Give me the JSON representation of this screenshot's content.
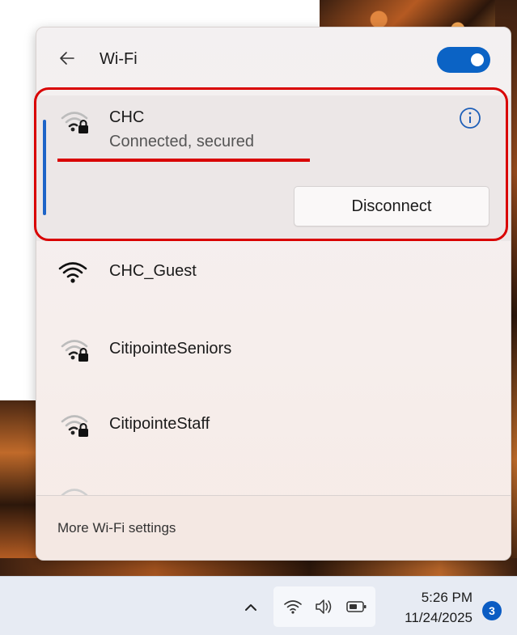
{
  "colors": {
    "accent": "#0b63c5",
    "annotation": "#d90000",
    "panel_bg": "#f3f0f1",
    "taskbar_bg": "#e7ebf3"
  },
  "header": {
    "back_icon": "back-arrow-icon",
    "title": "Wi-Fi",
    "toggle_state": "on"
  },
  "connected_network": {
    "name": "CHC",
    "status": "Connected, secured",
    "icon": "wifi-secured-icon",
    "info_icon": "info-icon",
    "disconnect_label": "Disconnect"
  },
  "networks": [
    {
      "name": "CHC_Guest",
      "icon": "wifi-icon"
    },
    {
      "name": "CitipointeSeniors",
      "icon": "wifi-secured-icon"
    },
    {
      "name": "CitipointeStaff",
      "icon": "wifi-secured-icon"
    }
  ],
  "footer": {
    "more_settings": "More Wi-Fi settings"
  },
  "taskbar": {
    "time": "5:26 PM",
    "date": "11/24/2025",
    "notification_count": "3",
    "icons": [
      "chevron-up-icon",
      "wifi-icon",
      "volume-icon",
      "battery-icon"
    ]
  }
}
